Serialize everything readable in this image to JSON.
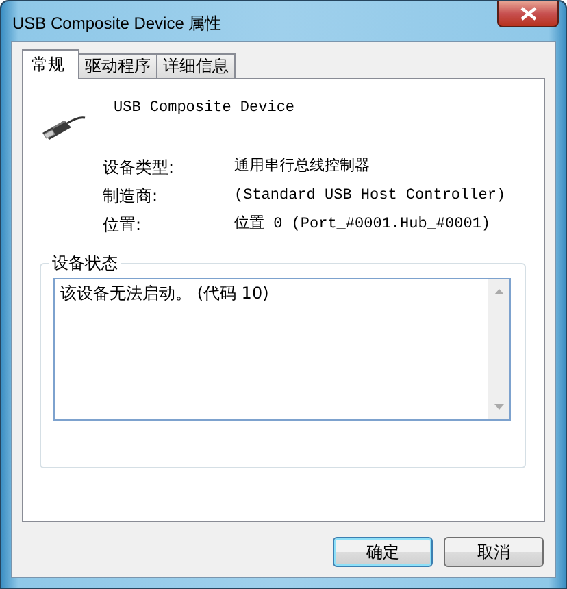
{
  "window": {
    "title": "USB Composite Device 属性"
  },
  "tabs": [
    {
      "label": "常规",
      "selected": true
    },
    {
      "label": "驱动程序",
      "selected": false
    },
    {
      "label": "详细信息",
      "selected": false
    }
  ],
  "device": {
    "name": "USB Composite Device"
  },
  "properties": [
    {
      "label": "设备类型:",
      "value": "通用串行总线控制器"
    },
    {
      "label": "制造商:",
      "value": "(Standard USB Host Controller)"
    },
    {
      "label": "位置:",
      "value": "位置 0 (Port_#0001.Hub_#0001)"
    }
  ],
  "device_status": {
    "title": "设备状态",
    "text": "该设备无法启动。 (代码 10)"
  },
  "buttons": [
    {
      "label": "确定",
      "default": true
    },
    {
      "label": "取消",
      "default": false
    }
  ]
}
